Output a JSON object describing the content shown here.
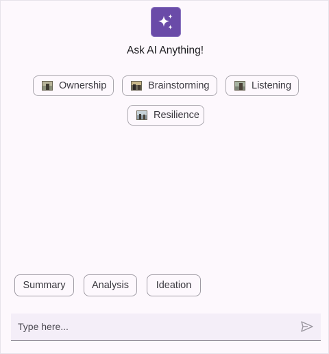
{
  "header": {
    "icon": "sparkle-icon",
    "title": "Ask AI Anything!",
    "accent": "#6a4ba8"
  },
  "topics": [
    {
      "label": "Ownership",
      "icon": "image-thumbnail-icon"
    },
    {
      "label": "Brainstorming",
      "icon": "image-thumbnail-icon"
    },
    {
      "label": "Listening",
      "icon": "image-thumbnail-icon"
    },
    {
      "label": "Resilience",
      "icon": "image-thumbnail-icon"
    }
  ],
  "quick_actions": [
    "Summary",
    "Analysis",
    "Ideation"
  ],
  "composer": {
    "placeholder": "Type here...",
    "value": "",
    "send_icon": "send-icon"
  }
}
